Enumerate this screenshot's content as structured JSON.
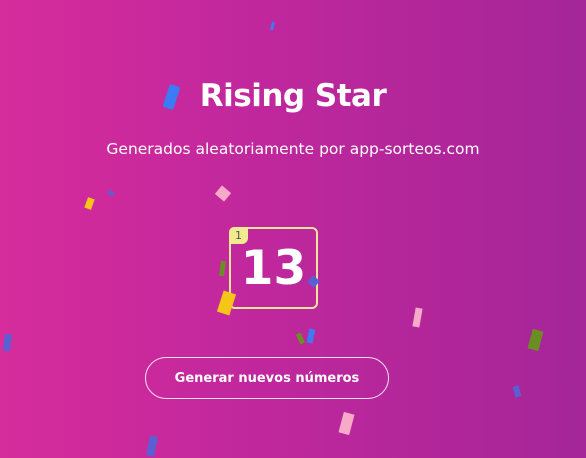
{
  "header": {
    "title": "Rising Star",
    "subtitle": "Generados aleatoriamente por app-sorteos.com"
  },
  "result": {
    "index": "1",
    "value": "13"
  },
  "actions": {
    "regenerate_label": "Generar nuevos números"
  },
  "colors": {
    "background_start": "#d62c9c",
    "background_end": "#a42698",
    "card_border": "#f0e39a",
    "index_badge": "#f2ea90"
  }
}
